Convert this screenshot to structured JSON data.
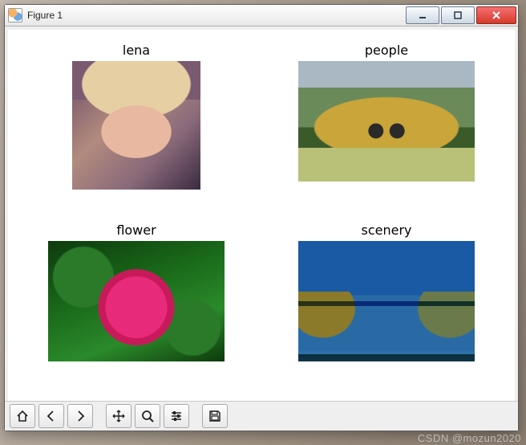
{
  "window": {
    "title": "Figure 1"
  },
  "subplots": [
    {
      "title": "lena",
      "img_class": "lena"
    },
    {
      "title": "people",
      "img_class": "people"
    },
    {
      "title": "flower",
      "img_class": "flower"
    },
    {
      "title": "scenery",
      "img_class": "scenery"
    }
  ],
  "toolbar": {
    "home": "home-icon",
    "back": "arrow-left-icon",
    "forward": "arrow-right-icon",
    "pan": "move-icon",
    "zoom": "zoom-icon",
    "config": "sliders-icon",
    "save": "save-icon"
  },
  "watermark": "CSDN @mozun2020"
}
